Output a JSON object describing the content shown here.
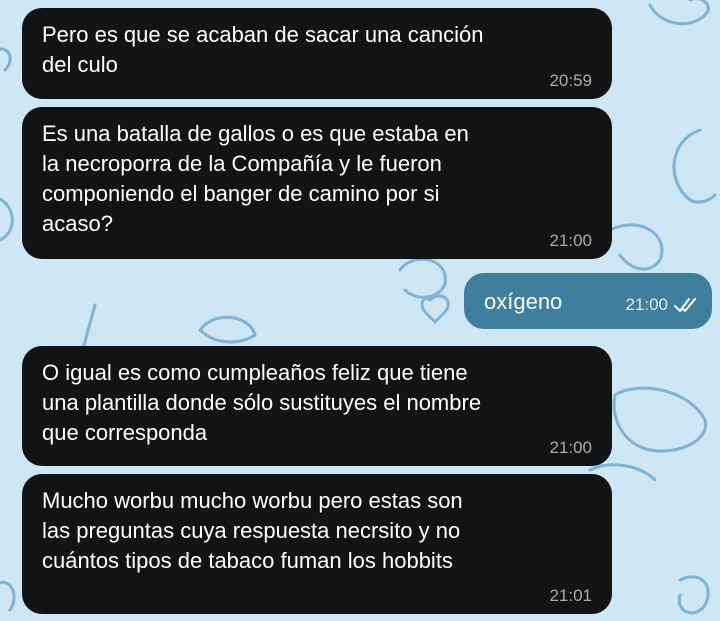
{
  "chat": {
    "messages": [
      {
        "direction": "in",
        "text": "Pero es que se acaban de sacar una canción\ndel culo",
        "time": "20:59"
      },
      {
        "direction": "in",
        "text": "Es una batalla de gallos o es que estaba en\nla necroporra de la Compañía y le fueron\ncomponiendo el banger de camino por si\nacaso?",
        "time": "21:00"
      },
      {
        "direction": "out",
        "text": "oxígeno",
        "time": "21:00",
        "status": "read"
      },
      {
        "direction": "in",
        "text": "O igual es como cumpleaños feliz que tiene\nuna plantilla donde sólo sustituyes el nombre\nque corresponda",
        "time": "21:00"
      },
      {
        "direction": "in",
        "text": "Mucho worbu mucho worbu pero estas son\nlas preguntas cuya respuesta necrsito y no\ncuántos tipos de tabaco fuman los hobbits",
        "time": "21:01"
      }
    ]
  },
  "colors": {
    "wallpaper": "#cfe6f4",
    "incoming_bubble": "#121315",
    "outgoing_bubble": "#3f7e9c",
    "doodle_stroke": "#7fb3d6"
  },
  "icons": {
    "read_status": "double-check-icon"
  }
}
